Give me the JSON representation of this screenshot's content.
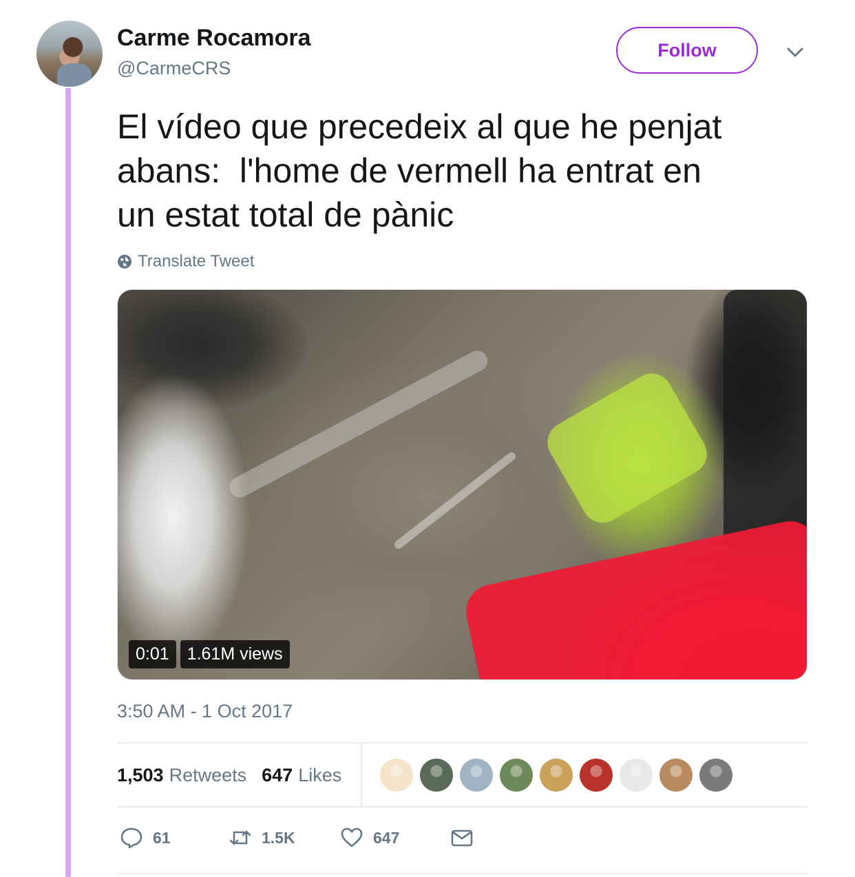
{
  "author": {
    "name": "Carme Rocamora",
    "handle": "@CarmeCRS",
    "follow_label": "Follow"
  },
  "tweet": {
    "text": "El vídeo que precedeix al que he penjat\nabans:  l'home de vermell ha entrat en\nun estat total de pànic",
    "translate_label": "Translate Tweet",
    "timestamp": "3:50 AM - 1 Oct 2017"
  },
  "video": {
    "duration": "0:01",
    "views": "1.61M views"
  },
  "stats": {
    "retweets_count": "1,503",
    "retweets_label": "Retweets",
    "likes_count": "647",
    "likes_label": "Likes"
  },
  "likers": [
    {
      "icon": "liker-avatar-1",
      "color": "#f4e3c8"
    },
    {
      "icon": "liker-avatar-2",
      "color": "#5b6b5a"
    },
    {
      "icon": "liker-avatar-3",
      "color": "#9fb3c4"
    },
    {
      "icon": "liker-avatar-4",
      "color": "#6f8a5a"
    },
    {
      "icon": "liker-avatar-5",
      "color": "#c9a15a"
    },
    {
      "icon": "liker-avatar-6",
      "color": "#b8322a"
    },
    {
      "icon": "liker-avatar-7",
      "color": "#e8e8e8"
    },
    {
      "icon": "liker-avatar-8",
      "color": "#b88a60"
    },
    {
      "icon": "liker-avatar-9",
      "color": "#7a7a7a"
    }
  ],
  "actions": {
    "reply_count": "61",
    "retweet_count": "1.5K",
    "like_count": "647"
  },
  "colors": {
    "accent": "#9a2bd8",
    "thread_line": "#d6a4f0",
    "muted_text": "#657786"
  }
}
